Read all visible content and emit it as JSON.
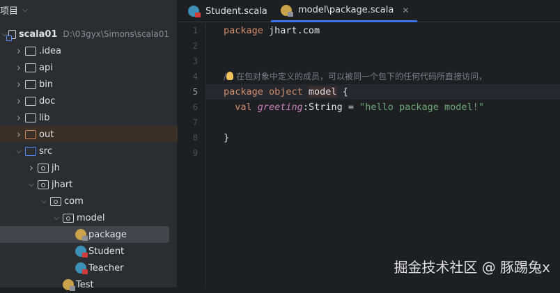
{
  "sidebar": {
    "title": "项目",
    "root": {
      "name": "scala01",
      "path": "D:\\03gyx\\Simons\\scala01"
    },
    "items": [
      ".idea",
      "api",
      "bin",
      "doc",
      "lib",
      "out",
      "src",
      "jh",
      "jhart",
      "com",
      "model",
      "package",
      "Student",
      "Teacher",
      "Test"
    ]
  },
  "tabs": [
    {
      "label": "Student.scala"
    },
    {
      "label": "model\\package.scala"
    }
  ],
  "editor": {
    "line_numbers": [
      "1",
      "2",
      "3",
      "4",
      "5",
      "6",
      "7",
      "8",
      "9"
    ],
    "l1a": "package",
    "l1b": " jhart.com",
    "l4a": "/",
    "l4b": "在包对象中定义的成员，可以被同一个包下的任何代码所直接访问，",
    "l5a": "package object ",
    "l5b": "model",
    "l5c": " {",
    "l6a": "  val ",
    "l6b": "greeting",
    ":": ":String = ",
    "l6d": "\"hello package model!\"",
    "l8": "}"
  },
  "watermark": "掘金技术社区 @ 豚踢兔x"
}
